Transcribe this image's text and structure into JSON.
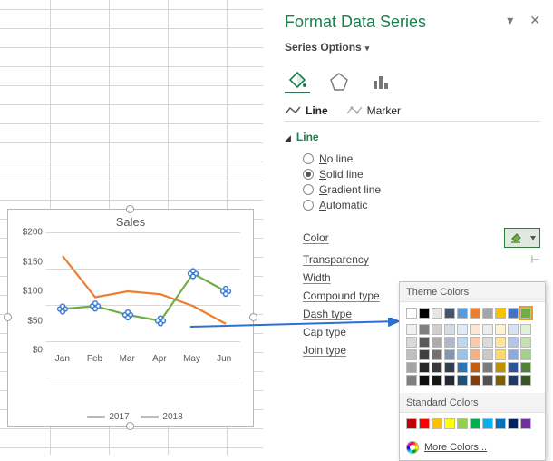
{
  "pane": {
    "title": "Format Data Series",
    "options_label": "Series Options",
    "tabs": {
      "line": "Line",
      "marker": "Marker"
    },
    "section": "Line",
    "radios": {
      "none": "No line",
      "solid": "Solid line",
      "gradient": "Gradient line",
      "auto": "Automatic"
    },
    "rows": {
      "color": "Color",
      "transparency": "Transparency",
      "width": "Width",
      "compound": "Compound type",
      "dash": "Dash type",
      "cap": "Cap type",
      "join": "Join type"
    }
  },
  "popup": {
    "theme_title": "Theme Colors",
    "standard_title": "Standard Colors",
    "more": "More Colors...",
    "theme_row1": [
      "#ffffff",
      "#000000",
      "#e7e6e6",
      "#44546a",
      "#5b9bd5",
      "#ed7d31",
      "#a5a5a5",
      "#ffc000",
      "#4472c4",
      "#70ad47"
    ],
    "theme_shades": [
      [
        "#f2f2f2",
        "#7f7f7f",
        "#d0cece",
        "#d6dce4",
        "#deebf6",
        "#fbe5d5",
        "#ededed",
        "#fff2cc",
        "#d9e2f3",
        "#e2efd9"
      ],
      [
        "#d8d8d8",
        "#595959",
        "#aeabab",
        "#adb9ca",
        "#bdd7ee",
        "#f7cbac",
        "#dbdbdb",
        "#fee599",
        "#b4c6e7",
        "#c5e0b3"
      ],
      [
        "#bfbfbf",
        "#3f3f3f",
        "#757070",
        "#8496b0",
        "#9cc3e5",
        "#f4b183",
        "#c9c9c9",
        "#ffd965",
        "#8eaadb",
        "#a8d08d"
      ],
      [
        "#a5a5a5",
        "#262626",
        "#3a3838",
        "#323f4f",
        "#2e75b5",
        "#c55a11",
        "#7b7b7b",
        "#bf9000",
        "#2f5496",
        "#538135"
      ],
      [
        "#7f7f7f",
        "#0c0c0c",
        "#171616",
        "#222a35",
        "#1f4e79",
        "#833c0b",
        "#525252",
        "#7f6000",
        "#1f3864",
        "#375623"
      ]
    ],
    "standard": [
      "#c00000",
      "#ff0000",
      "#ffc000",
      "#ffff00",
      "#92d050",
      "#00b050",
      "#00b0f0",
      "#0070c0",
      "#002060",
      "#7030a0"
    ],
    "selected_color": "#70ad47"
  },
  "chart_data": {
    "type": "line",
    "title": "Sales",
    "categories": [
      "Jan",
      "Feb",
      "Mar",
      "Apr",
      "May",
      "Jun"
    ],
    "ylim": [
      0,
      200
    ],
    "yticks": [
      0,
      50,
      100,
      150,
      200
    ],
    "ytick_labels": [
      "$0",
      "$50",
      "$100",
      "$150",
      "$200"
    ],
    "series": [
      {
        "name": "2017",
        "color": "#ed7d31",
        "values": [
          160,
          90,
          100,
          95,
          75,
          45
        ]
      },
      {
        "name": "2018",
        "color": "#70ad47",
        "values": [
          70,
          75,
          60,
          50,
          130,
          100
        ],
        "selected": true
      }
    ],
    "legend_position": "bottom"
  }
}
